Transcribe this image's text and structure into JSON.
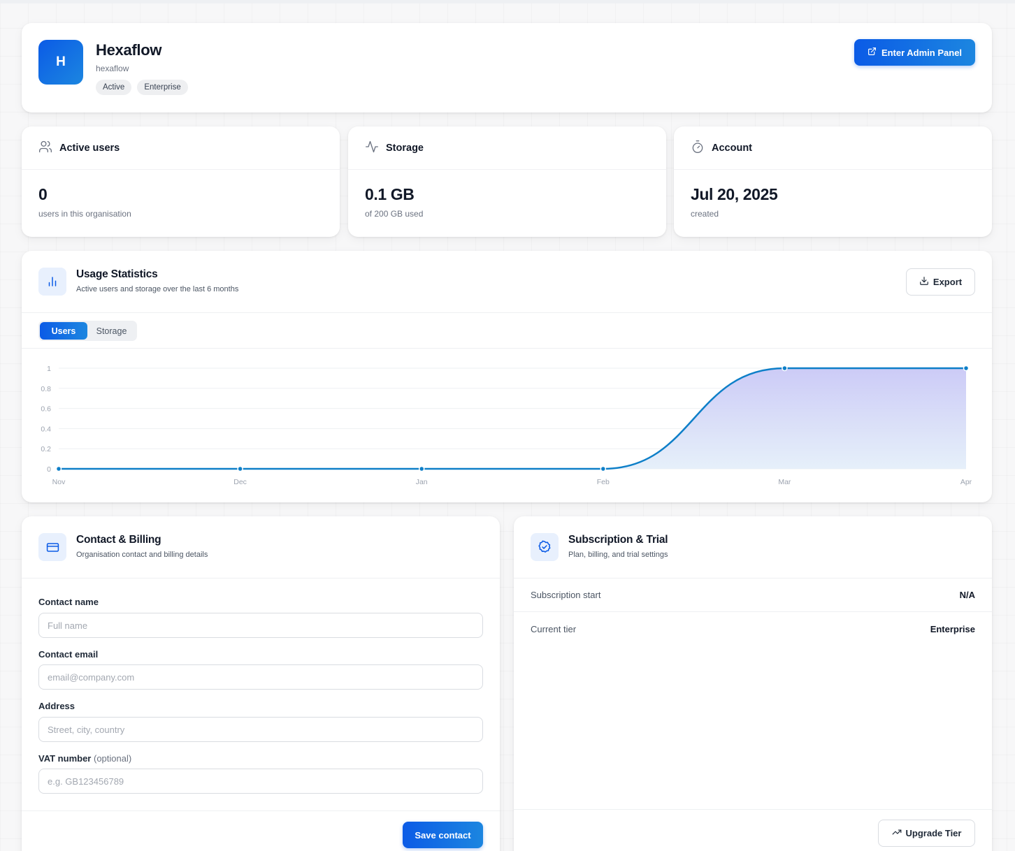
{
  "org": {
    "logo_letter": "H",
    "name": "Hexaflow",
    "slug": "hexaflow",
    "badges": [
      "Active",
      "Enterprise"
    ],
    "admin_button": "Enter Admin Panel"
  },
  "stats": [
    {
      "icon": "users-icon",
      "label": "Active users",
      "value": "0",
      "sub": "users in this organisation"
    },
    {
      "icon": "activity-icon",
      "label": "Storage",
      "value": "0.1 GB",
      "sub": "of 200 GB used"
    },
    {
      "icon": "timer-icon",
      "label": "Account",
      "value": "Jul 20, 2025",
      "sub": "created"
    }
  ],
  "usage": {
    "title": "Usage Statistics",
    "subtitle": "Active users and storage over the last 6 months",
    "export_label": "Export",
    "tabs": [
      "Users",
      "Storage"
    ],
    "active_tab": "Users"
  },
  "chart_data": {
    "type": "area",
    "title": "",
    "xlabel": "",
    "ylabel": "",
    "categories": [
      "Nov",
      "Dec",
      "Jan",
      "Feb",
      "Mar",
      "Apr"
    ],
    "series": [
      {
        "values": [
          0,
          0,
          0,
          0,
          1,
          1
        ]
      }
    ],
    "ylim": [
      0,
      1
    ],
    "yticks": [
      "1",
      "0.8",
      "0.6",
      "0.4",
      "0.2",
      "0"
    ],
    "grid": true,
    "colors": {
      "line": "#0e7fc8",
      "fill_top": "#c9c8f6",
      "fill_bottom": "#e3eef9"
    }
  },
  "contact": {
    "title": "Contact & Billing",
    "subtitle": "Organisation contact and billing details",
    "fields": [
      {
        "label": "Contact name",
        "placeholder": "Full name",
        "value": ""
      },
      {
        "label": "Contact email",
        "placeholder": "email@company.com",
        "value": ""
      },
      {
        "label": "Address",
        "placeholder": "Street, city, country",
        "value": ""
      },
      {
        "label": "VAT number",
        "optional": "(optional)",
        "placeholder": "e.g. GB123456789",
        "value": ""
      }
    ],
    "save_label": "Save contact"
  },
  "subscription": {
    "title": "Subscription & Trial",
    "subtitle": "Plan, billing, and trial settings",
    "rows": [
      {
        "key": "Subscription start",
        "value": "N/A"
      },
      {
        "key": "Current tier",
        "value": "Enterprise"
      }
    ],
    "upgrade_label": "Upgrade Tier"
  },
  "colors": {
    "accent": "#0b5be6",
    "accent2": "#1c86e0"
  }
}
